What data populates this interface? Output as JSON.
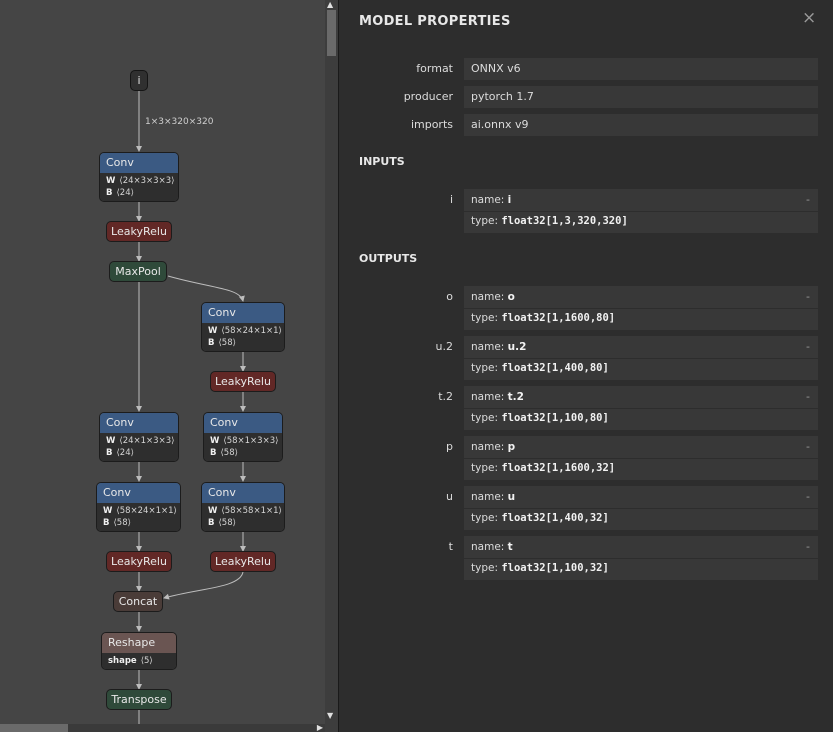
{
  "graph": {
    "input_label": "i",
    "input_shape": "1×3×320×320",
    "nodes": {
      "conv1": {
        "title": "Conv",
        "w": "⟨24×3×3×3⟩",
        "b": "⟨24⟩"
      },
      "relu1": {
        "title": "LeakyRelu"
      },
      "pool1": {
        "title": "MaxPool"
      },
      "conv2": {
        "title": "Conv",
        "w": "⟨58×24×1×1⟩",
        "b": "⟨58⟩"
      },
      "relu2": {
        "title": "LeakyRelu"
      },
      "conv3": {
        "title": "Conv",
        "w": "⟨24×1×3×3⟩",
        "b": "⟨24⟩"
      },
      "conv4": {
        "title": "Conv",
        "w": "⟨58×1×3×3⟩",
        "b": "⟨58⟩"
      },
      "conv5": {
        "title": "Conv",
        "w": "⟨58×24×1×1⟩",
        "b": "⟨58⟩"
      },
      "conv6": {
        "title": "Conv",
        "w": "⟨58×58×1×1⟩",
        "b": "⟨58⟩"
      },
      "relu3": {
        "title": "LeakyRelu"
      },
      "relu4": {
        "title": "LeakyRelu"
      },
      "concat1": {
        "title": "Concat"
      },
      "reshape1": {
        "title": "Reshape",
        "attr_name": "shape",
        "attr_val": "⟨5⟩"
      },
      "transpose1": {
        "title": "Transpose"
      }
    },
    "attr_w": "W",
    "attr_b": "B"
  },
  "panel": {
    "title": "MODEL PROPERTIES",
    "close": "×",
    "properties": [
      {
        "label": "format",
        "value": "ONNX v6"
      },
      {
        "label": "producer",
        "value": "pytorch 1.7"
      },
      {
        "label": "imports",
        "value": "ai.onnx v9"
      }
    ],
    "inputs_heading": "INPUTS",
    "inputs": [
      {
        "label": "i",
        "name": "i",
        "type": "float32[1,3,320,320]"
      }
    ],
    "outputs_heading": "OUTPUTS",
    "outputs": [
      {
        "label": "o",
        "name": "o",
        "type": "float32[1,1600,80]"
      },
      {
        "label": "u.2",
        "name": "u.2",
        "type": "float32[1,400,80]"
      },
      {
        "label": "t.2",
        "name": "t.2",
        "type": "float32[1,100,80]"
      },
      {
        "label": "p",
        "name": "p",
        "type": "float32[1,1600,32]"
      },
      {
        "label": "u",
        "name": "u",
        "type": "float32[1,400,32]"
      },
      {
        "label": "t",
        "name": "t",
        "type": "float32[1,100,32]"
      }
    ],
    "name_prefix": "name: ",
    "type_prefix": "type: ",
    "dash": "-"
  }
}
